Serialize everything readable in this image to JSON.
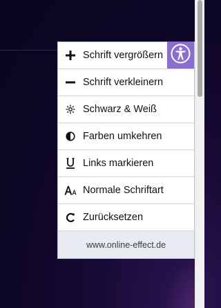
{
  "menu": {
    "items": [
      {
        "icon": "plus-icon",
        "label": "Schrift vergrößern"
      },
      {
        "icon": "minus-icon",
        "label": "Schrift verkleinern"
      },
      {
        "icon": "grayscale-icon",
        "label": "Schwarz & Weiß"
      },
      {
        "icon": "contrast-icon",
        "label": "Farben umkehren"
      },
      {
        "icon": "underline-icon",
        "label": "Links markieren"
      },
      {
        "icon": "font-icon",
        "label": "Normale Schriftart"
      },
      {
        "icon": "reset-icon",
        "label": "Zurücksetzen"
      }
    ],
    "footer": "www.online-effect.de"
  },
  "toggle": {
    "icon": "accessibility-icon"
  },
  "colors": {
    "accent": "#8a6ecb",
    "panel_border": "#b9c4d2",
    "footer_bg": "#e8ecf2"
  }
}
